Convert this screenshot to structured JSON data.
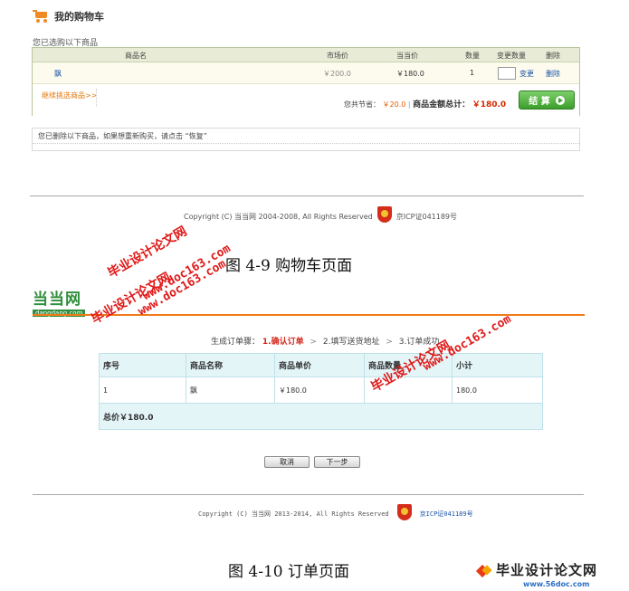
{
  "cart": {
    "title": "我的购物车",
    "selected_caption": "您已选购以下商品",
    "columns": [
      "商品名",
      "市场价",
      "当当价",
      "数量",
      "变更数量",
      "删除"
    ],
    "items": [
      {
        "name": "飘",
        "market_price": "￥200.0",
        "dangdang_price": "￥180.0",
        "quantity": "1",
        "change_label": "变更",
        "delete_label": "删除"
      }
    ],
    "continue_label": "继续挑选商品>>",
    "saving_label": "您共节省：",
    "saving_value": "￥20.0",
    "total_label": "商品金额总计：",
    "total_value": "￥180.0",
    "checkout_label": "结 算"
  },
  "deleted": {
    "text": "您已删除以下商品，如果想重新购买，请点击 “恢复”"
  },
  "footer1": {
    "copyright": "Copyright (C) 当当网 2004-2008, All Rights Reserved",
    "icp": "京ICP证041189号"
  },
  "captions": {
    "fig1": "图 4-9 购物车页面",
    "fig2": "图 4-10  订单页面"
  },
  "order": {
    "logo_main": "当当网",
    "logo_sub": "dangdang.com",
    "steps_label": "生成订单骤：",
    "steps": [
      "1.确认订单",
      "2.填写送货地址",
      "3.订单成功"
    ],
    "columns": [
      "序号",
      "商品名称",
      "商品单价",
      "商品数量",
      "小计"
    ],
    "rows": [
      {
        "index": "1",
        "name": "飘",
        "unit_price": "￥180.0",
        "quantity": "",
        "subtotal": "180.0"
      }
    ],
    "total": "总价￥180.0",
    "cancel_label": "取消",
    "next_label": "下一步"
  },
  "footer2": {
    "copyright": "Copyright (C) 当当网 2013-2014, All Rights Reserved",
    "icp": "京ICP证041189号"
  },
  "watermarks": {
    "cn": "毕业设计论文网",
    "url": "www.doc163.com"
  },
  "brand": {
    "name": "毕业设计论文网",
    "url": "www.56doc.com"
  },
  "colors": {
    "accent_orange": "#f07b1a",
    "logo_green": "#2f8f3c",
    "watermark_red": "#e01818",
    "checkout_green": "#3c9e2a"
  }
}
